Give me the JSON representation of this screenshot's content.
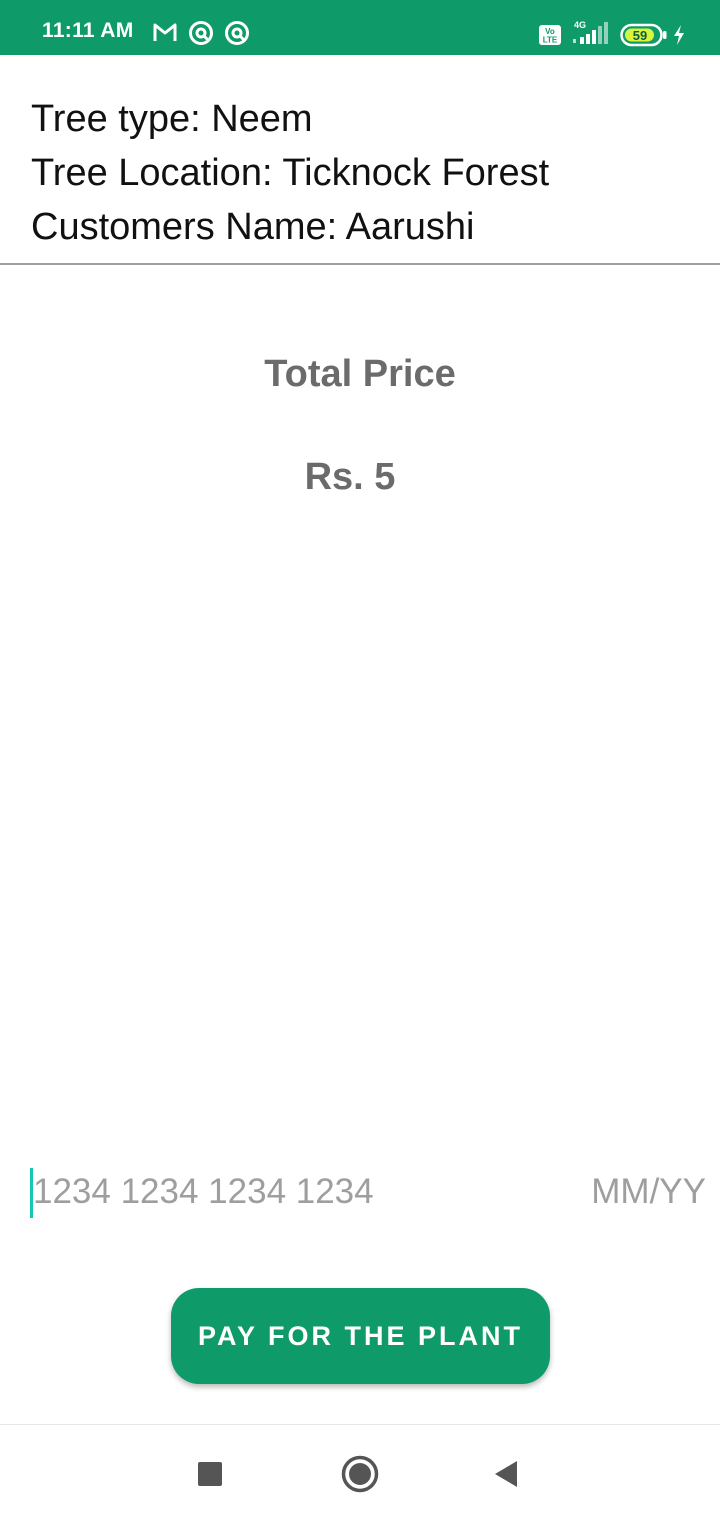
{
  "status_bar": {
    "time": "11:11 AM",
    "battery_level": "59",
    "left_icons": [
      "gmail-icon",
      "notification-app-icon",
      "notification-app-icon"
    ],
    "right_icons": [
      "volte-icon",
      "4g-signal-icon",
      "battery-icon",
      "charging-icon"
    ],
    "network_label": "4G",
    "volte_label": "Vo LTE",
    "color": "#0f9a69"
  },
  "order": {
    "tree_type": "Tree type: Neem",
    "tree_location": "Tree Location: Ticknock Forest",
    "customer_name": "Customers Name: Aarushi"
  },
  "price": {
    "title": "Total Price",
    "amount": "Rs. 5"
  },
  "card_input": {
    "number_placeholder": "1234 1234 1234 1234",
    "expiry_placeholder": "MM/YY"
  },
  "pay_button": {
    "label": "PAY FOR THE PLANT",
    "color": "#0f9a69"
  },
  "nav_bar": {
    "buttons": [
      "recents-square-icon",
      "home-circle-icon",
      "back-triangle-icon"
    ]
  }
}
